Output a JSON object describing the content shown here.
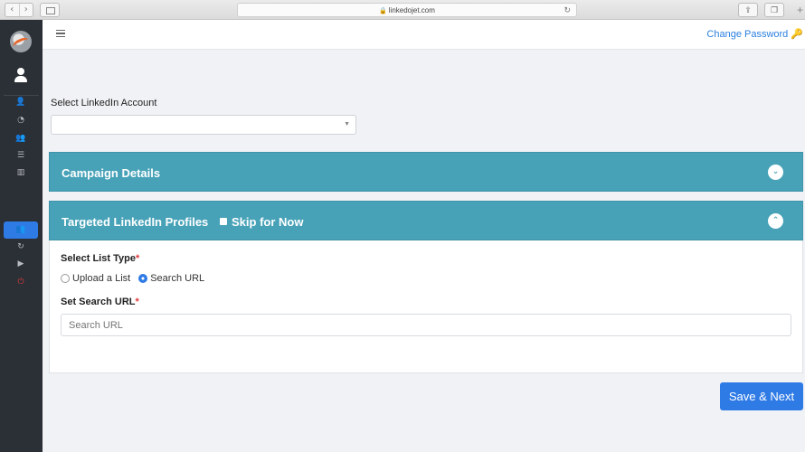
{
  "browser": {
    "url": "linkedojet.com",
    "back_icon": "chevron-left-icon",
    "forward_icon": "chevron-right-icon"
  },
  "sidebar": {
    "items": [
      {
        "name": "add-user-icon",
        "glyph": "👤"
      },
      {
        "name": "dashboard-icon",
        "glyph": "◔"
      },
      {
        "name": "users-icon",
        "glyph": "👥"
      },
      {
        "name": "list-icon",
        "glyph": "☰"
      },
      {
        "name": "book-icon",
        "glyph": "▥"
      },
      {
        "name": "group-icon",
        "glyph": "👥",
        "active": true
      },
      {
        "name": "refresh-icon",
        "glyph": "↻"
      },
      {
        "name": "play-icon",
        "glyph": "▶"
      },
      {
        "name": "power-icon",
        "glyph": "⏻"
      }
    ],
    "active_color": "#2f7be6"
  },
  "topbar": {
    "change_password": "Change Password"
  },
  "account": {
    "label": "Select LinkedIn Account",
    "value": ""
  },
  "campaign_panel": {
    "title": "Campaign Details",
    "toggle_icon": "chevron-down-icon"
  },
  "targeted_panel": {
    "title": "Targeted LinkedIn Profiles",
    "skip_label": "Skip for Now",
    "toggle_icon": "chevron-up-icon",
    "list_type_label": "Select List Type",
    "options": [
      "Upload a List",
      "Search URL"
    ],
    "selected_option": "Search URL",
    "search_url_label": "Set Search URL",
    "search_url_placeholder": "Search URL",
    "required_mark": "*"
  },
  "footer": {
    "save_next": "Save & Next"
  },
  "colors": {
    "panel_header": "#47a2b8",
    "primary": "#2f7be6",
    "sidebar_bg": "#2b2f36"
  }
}
